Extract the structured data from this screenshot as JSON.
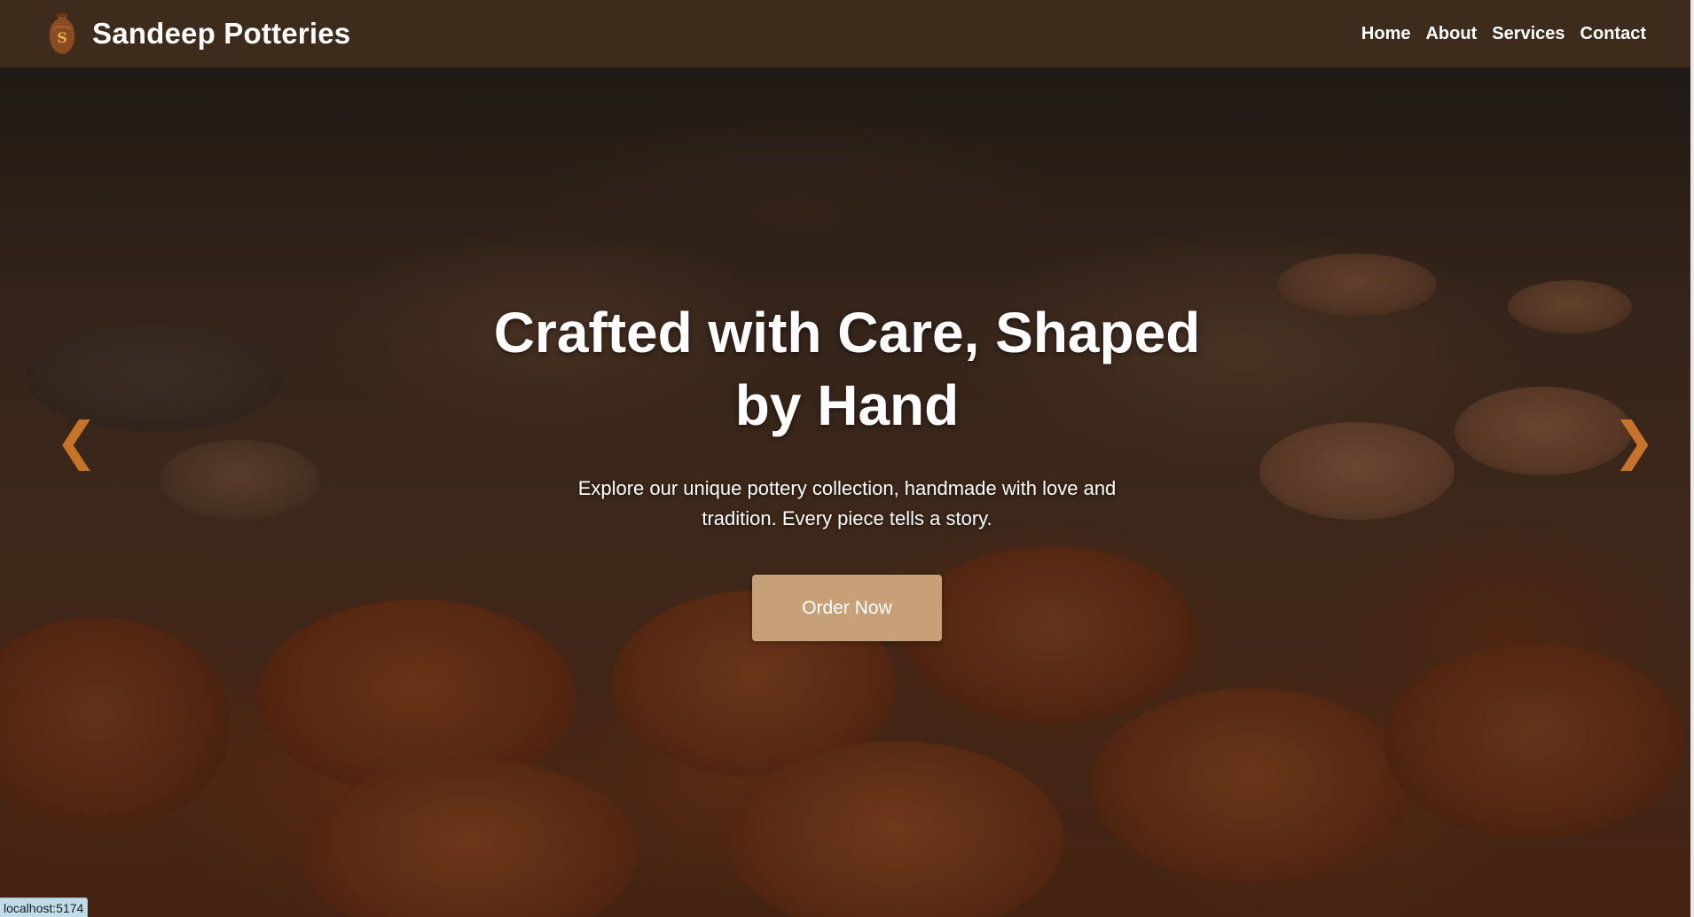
{
  "brand": {
    "name": "Sandeep Potteries",
    "logo_letter": "S",
    "logo_icon": "vase-icon"
  },
  "nav": {
    "items": [
      "Home",
      "About",
      "Services",
      "Contact"
    ]
  },
  "hero": {
    "title": "Crafted with Care, Shaped by Hand",
    "subtitle": "Explore our unique pottery collection, handmade with love and tradition. Every piece tells a story.",
    "button_label": "Order Now",
    "prev_arrow": "❮",
    "next_arrow": "❯"
  },
  "status_bar": {
    "url": "localhost:5174"
  },
  "colors": {
    "header_bg": "#3d2b1c",
    "button_bg": "#c8a078",
    "arrow": "#c87428"
  }
}
